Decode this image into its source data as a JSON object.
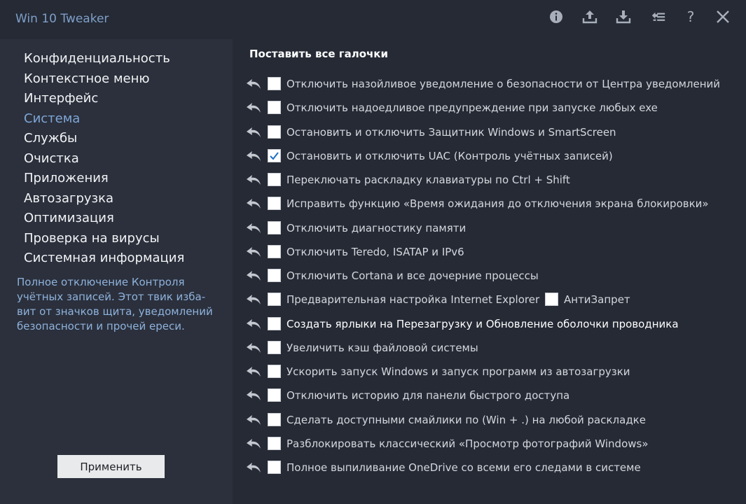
{
  "app": {
    "title": "Win 10 Tweaker"
  },
  "toolbar": {
    "icons": [
      "info-icon",
      "upload-icon",
      "download-icon",
      "list-icon",
      "help-icon",
      "close-icon"
    ],
    "help_glyph": "?"
  },
  "sidebar": {
    "items": [
      {
        "label": "Конфиденциальность",
        "active": false
      },
      {
        "label": "Контекстное меню",
        "active": false
      },
      {
        "label": "Интерфейс",
        "active": false
      },
      {
        "label": "Система",
        "active": true
      },
      {
        "label": "Службы",
        "active": false
      },
      {
        "label": "Очистка",
        "active": false
      },
      {
        "label": "Приложения",
        "active": false
      },
      {
        "label": "Автозагрузка",
        "active": false
      },
      {
        "label": "Оптимизация",
        "active": false
      },
      {
        "label": "Проверка на вирусы",
        "active": false
      },
      {
        "label": "Системная информация",
        "active": false
      }
    ],
    "description": [
      "Полное отключение Контроля",
      "учётных записей. Этот твик изба-",
      "вит от значков щита, уведомлений",
      "безопасности и прочей ереси."
    ],
    "apply_label": "Применить"
  },
  "main": {
    "check_all_label": "Поставить все галочки",
    "options": [
      {
        "label": "Отключить назойливое уведомление о безопасности от Центра уведомлений",
        "checked": false
      },
      {
        "label": "Отключить надоедливое предупреждение при запуске любых exe",
        "checked": false
      },
      {
        "label": "Остановить и отключить Защитник Windows и SmartScreen",
        "checked": false
      },
      {
        "label": "Остановить и отключить UAC (Контроль учётных записей)",
        "checked": true
      },
      {
        "label": "Переключать раскладку клавиатуры по Ctrl + Shift",
        "checked": false
      },
      {
        "label": "Исправить функцию «Время ожидания до отключения экрана блокировки»",
        "checked": false
      },
      {
        "label": "Отключить диагностику памяти",
        "checked": false
      },
      {
        "label": "Отключить Teredo, ISATAP и IPv6",
        "checked": false
      },
      {
        "label": "Отключить Cortana и все дочерние процессы",
        "checked": false
      },
      {
        "label": "Предварительная настройка Internet Explorer",
        "checked": false,
        "extra": {
          "label": "АнтиЗапрет",
          "checked": false
        }
      },
      {
        "label": "Создать ярлыки на Перезагрузку и Обновление оболочки проводника",
        "checked": false,
        "bright": true
      },
      {
        "label": "Увеличить кэш файловой системы",
        "checked": false
      },
      {
        "label": "Ускорить запуск Windows и запуск программ из автозагрузки",
        "checked": false
      },
      {
        "label": "Отключить историю для панели быстрого доступа",
        "checked": false
      },
      {
        "label": "Сделать доступными смайлики по (Win + .) на любой раскладке",
        "checked": false
      },
      {
        "label": "Разблокировать классический «Просмотр фотографий Windows»",
        "checked": false
      },
      {
        "label": "Полное выпиливание OneDrive со всеми его следами в системе",
        "checked": false
      }
    ]
  },
  "colors": {
    "background": "#252a35",
    "sidebar": "#2b303c",
    "accent": "#7fa6d6",
    "description": "#8fb2dc",
    "title": "#7f9fc8",
    "check": "#1f6fc4"
  }
}
